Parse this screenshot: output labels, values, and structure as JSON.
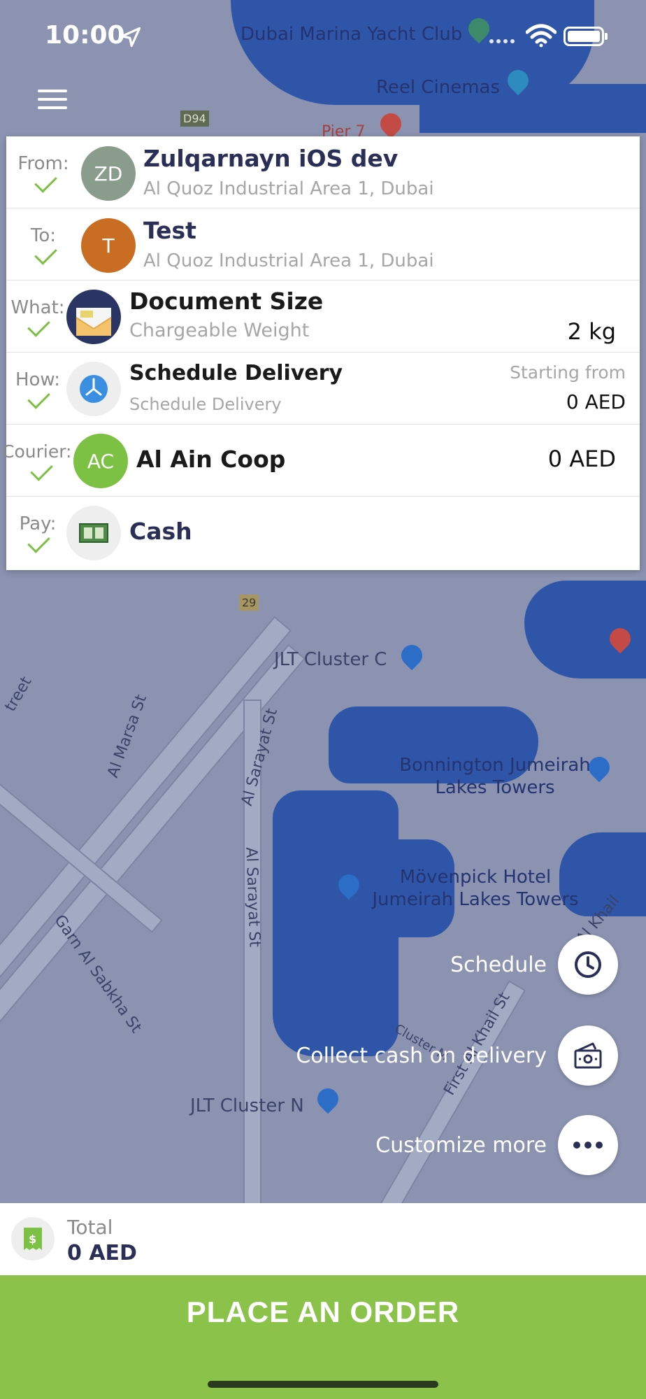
{
  "status_bar": {
    "time": "10:00"
  },
  "map": {
    "labels": [
      "Dubai Marina Yacht Club",
      "Reel Cinemas",
      "D94",
      "Pier 7",
      "29",
      "JLT Cluster C",
      "Al Marsa St",
      "Al Sarayat St",
      "Bonnington Jumeirah Lakes Towers",
      "Mövenpick Hotel Jumeirah Lakes Towers",
      "Al Sarayat St",
      "Garn Al Sabkha St",
      "Cluster M",
      "First Al Khail St",
      "Al Khail St",
      "JLT Cluster N",
      "treet"
    ]
  },
  "order": {
    "from": {
      "label": "From:",
      "initials": "ZD",
      "name": "Zulqarnayn iOS dev",
      "address": "Al Quoz Industrial Area 1, Dubai"
    },
    "to": {
      "label": "To:",
      "initials": "T",
      "name": "Test",
      "address": "Al Quoz Industrial Area 1, Dubai"
    },
    "what": {
      "label": "What:",
      "title": "Document Size",
      "subtitle": "Chargeable Weight",
      "value": "2 kg"
    },
    "how": {
      "label": "How:",
      "title": "Schedule Delivery",
      "subtitle": "Schedule Delivery",
      "price_note": "Starting from",
      "price": "0 AED"
    },
    "courier": {
      "label": "Courier:",
      "initials": "AC",
      "name": "Al Ain Coop",
      "price": "0 AED"
    },
    "pay": {
      "label": "Pay:",
      "method": "Cash"
    }
  },
  "actions": {
    "schedule": "Schedule",
    "collect_cash": "Collect cash on delivery",
    "customize": "Customize more"
  },
  "total": {
    "label": "Total",
    "value": "0 AED"
  },
  "place_order_label": "PLACE AN ORDER",
  "colors": {
    "accent_green": "#8bc34a",
    "navy_text": "#2b2e57",
    "check_green": "#7cc143"
  },
  "icons": [
    "location-arrow-icon",
    "wifi-icon",
    "battery-icon",
    "menu-icon",
    "check-icon",
    "envelope-icon",
    "clock-icon",
    "cash-icon",
    "cash-register-icon",
    "more-icon",
    "receipt-icon"
  ]
}
